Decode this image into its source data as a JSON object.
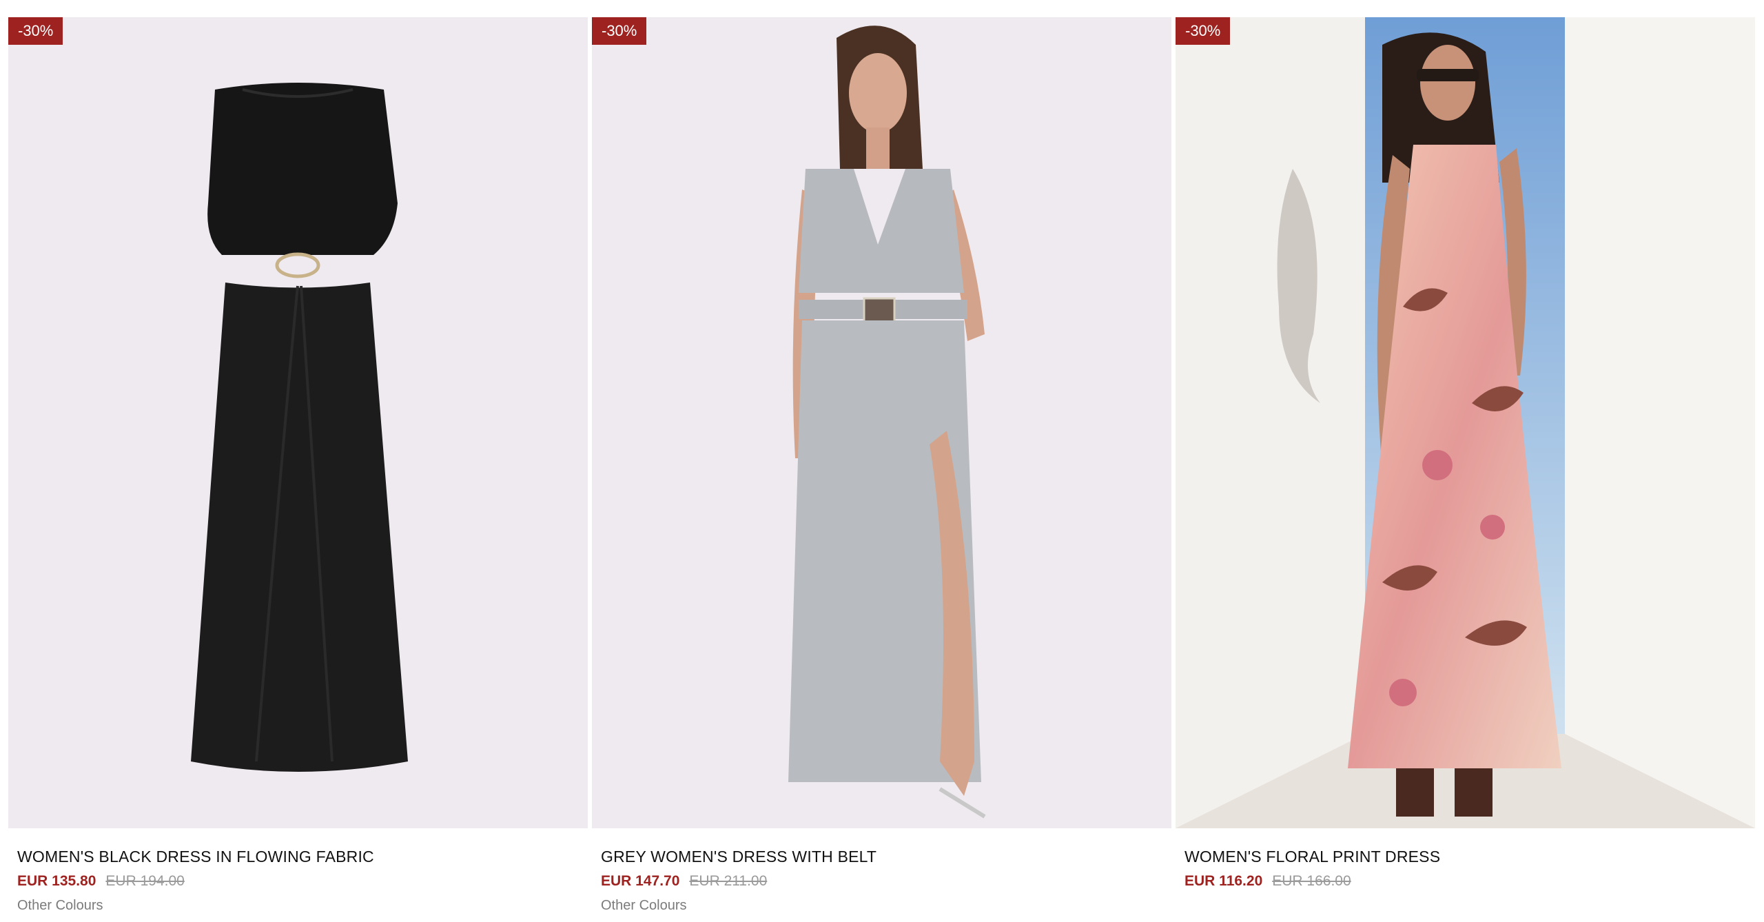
{
  "products": [
    {
      "badge": "-30%",
      "name": "WOMEN'S BLACK DRESS IN FLOWING FABRIC",
      "price": "EUR 135.80",
      "old_price": "EUR 194.00",
      "other_colours": "Other Colours",
      "bg_color": "#efeaef"
    },
    {
      "badge": "-30%",
      "name": "GREY WOMEN'S DRESS WITH BELT",
      "price": "EUR 147.70",
      "old_price": "EUR 211.00",
      "other_colours": "Other Colours",
      "bg_color": "#efeaef"
    },
    {
      "badge": "-30%",
      "name": "WOMEN'S FLORAL PRINT DRESS",
      "price": "EUR 116.20",
      "old_price": "EUR 166.00"
    }
  ],
  "colors": {
    "badge": "#9e2320",
    "sale_price": "#9e2320",
    "old_price": "#9a9a9a"
  }
}
